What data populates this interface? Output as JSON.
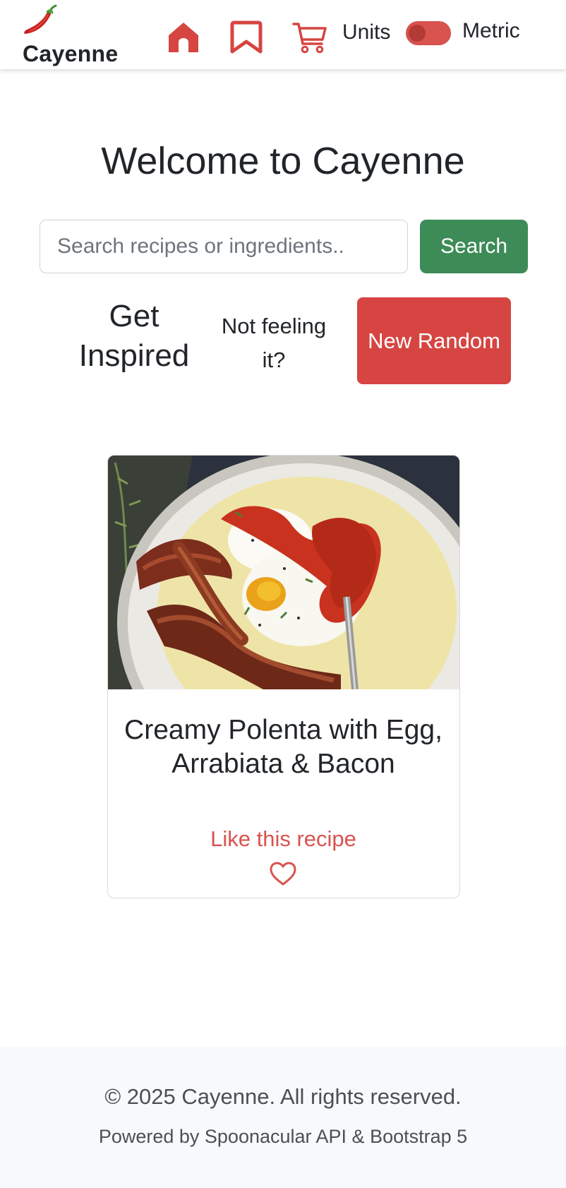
{
  "brand": {
    "name": "Cayenne",
    "icon": "chili-pepper-icon"
  },
  "nav": {
    "items": [
      {
        "icon": "home-icon"
      },
      {
        "icon": "bookmark-icon"
      },
      {
        "icon": "cart-icon"
      }
    ],
    "units_label": "Units",
    "units_value": "Metric",
    "units_toggle_on": false
  },
  "main": {
    "title": "Welcome to Cayenne",
    "search": {
      "placeholder": "Search recipes or ingredients..",
      "value": "",
      "button_label": "Search"
    },
    "inspire": {
      "heading": "Get Inspired",
      "prompt": "Not feeling it?",
      "button_label": "New Random"
    }
  },
  "card": {
    "image_alt": "Creamy Polenta with Egg, Arrabiata & Bacon",
    "title": "Creamy Polenta with Egg, Arrabiata & Bacon",
    "like_label": "Like this recipe",
    "like_icon": "heart-outline-icon"
  },
  "footer": {
    "copyright": "© 2025 Cayenne. All rights reserved.",
    "powered": "Powered by Spoonacular API & Bootstrap 5"
  },
  "colors": {
    "accent_red": "#d9534f",
    "button_red": "#d64541",
    "search_green": "#3d8b57",
    "footer_bg": "#f8f9fa"
  }
}
